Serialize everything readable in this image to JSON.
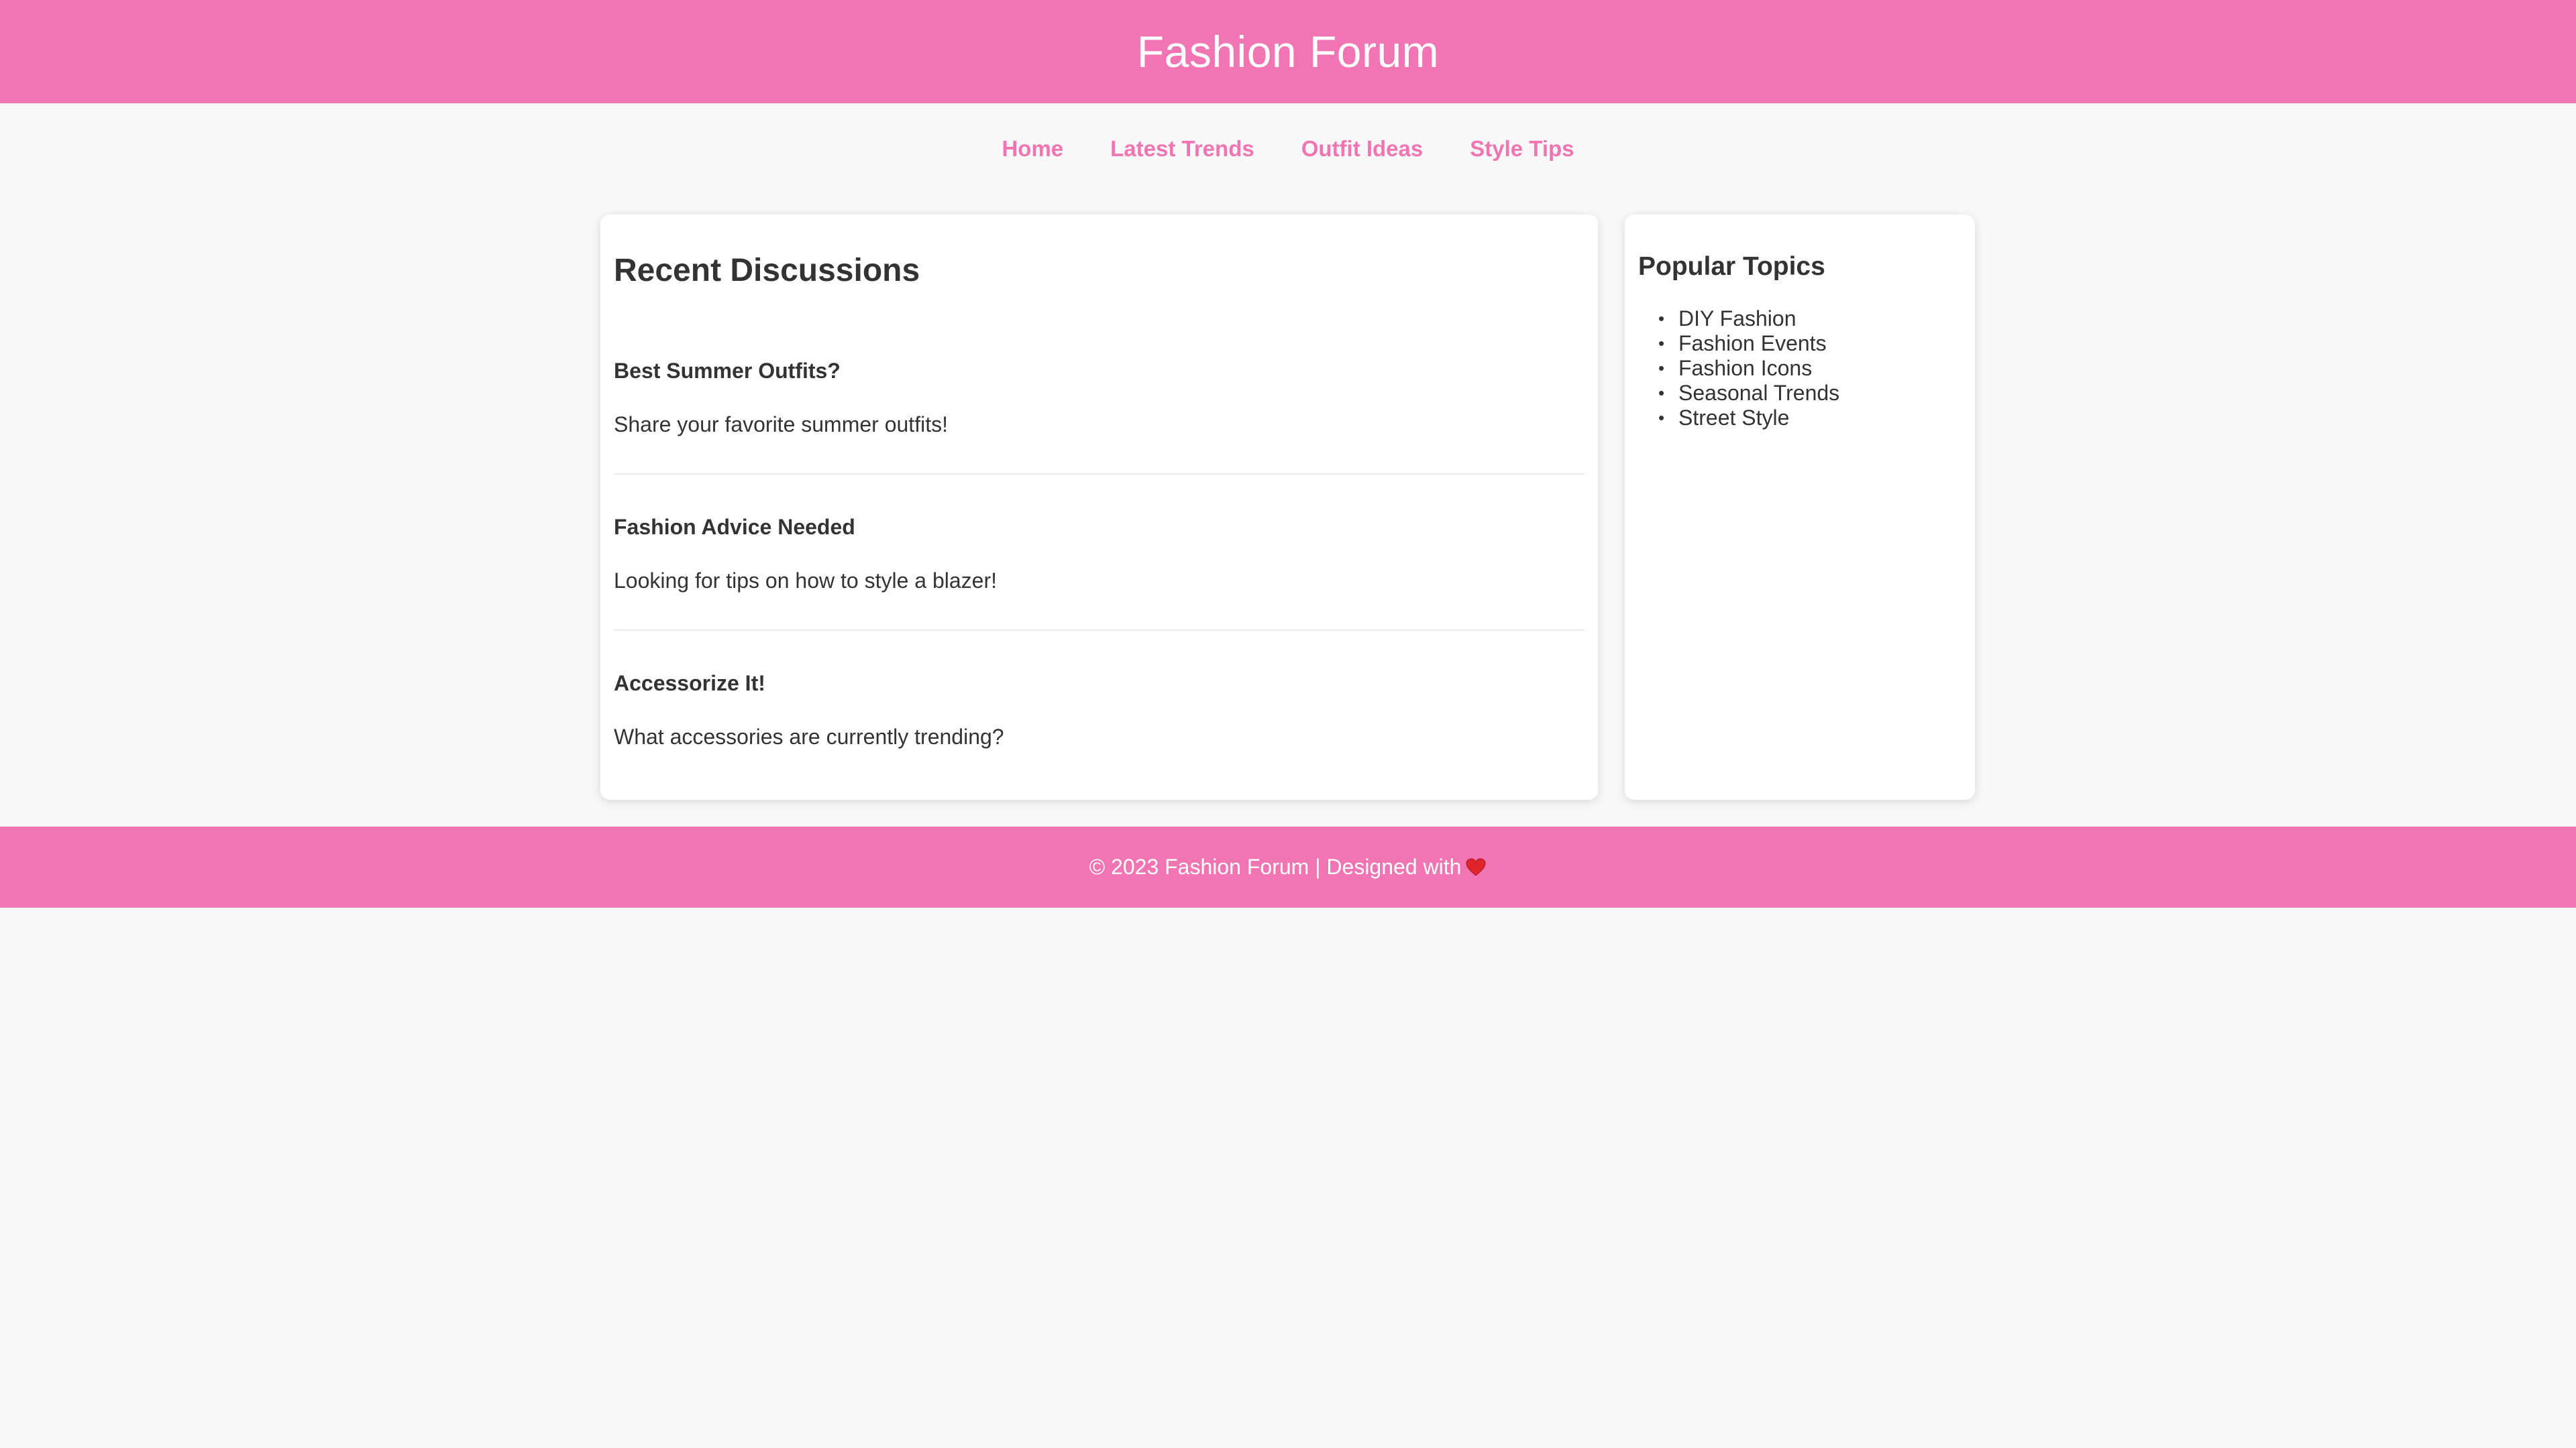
{
  "header": {
    "title": "Fashion Forum"
  },
  "nav": {
    "items": [
      {
        "label": "Home"
      },
      {
        "label": "Latest Trends"
      },
      {
        "label": "Outfit Ideas"
      },
      {
        "label": "Style Tips"
      }
    ]
  },
  "main": {
    "heading": "Recent Discussions",
    "discussions": [
      {
        "title": "Best Summer Outfits?",
        "body": "Share your favorite summer outfits!"
      },
      {
        "title": "Fashion Advice Needed",
        "body": "Looking for tips on how to style a blazer!"
      },
      {
        "title": "Accessorize It!",
        "body": "What accessories are currently trending?"
      }
    ]
  },
  "sidebar": {
    "heading": "Popular Topics",
    "topics": [
      {
        "label": "DIY Fashion"
      },
      {
        "label": "Fashion Events"
      },
      {
        "label": "Fashion Icons"
      },
      {
        "label": "Seasonal Trends"
      },
      {
        "label": "Street Style"
      }
    ]
  },
  "footer": {
    "text": "© 2023 Fashion Forum | Designed with",
    "icon": "heart-icon"
  },
  "colors": {
    "accent": "#f075b2",
    "background": "#f8f8f8",
    "card": "#ffffff",
    "text": "#333333"
  }
}
